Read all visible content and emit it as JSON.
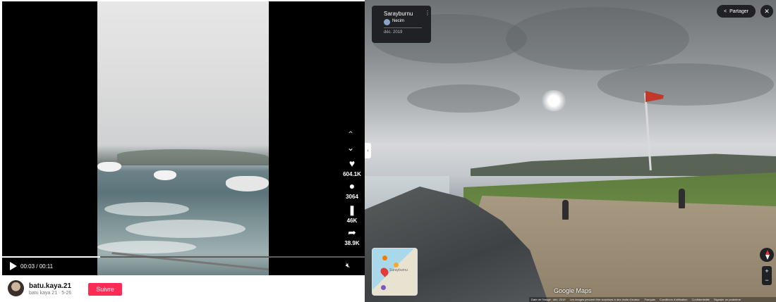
{
  "video": {
    "chevron_up": "⌃",
    "chevron_down": "⌄",
    "actions": [
      {
        "icon": "heart-icon",
        "count": "604.1K"
      },
      {
        "icon": "comment-icon",
        "count": "3064"
      },
      {
        "icon": "bookmark-icon",
        "count": "46K"
      },
      {
        "icon": "share-icon",
        "count": "38.9K"
      }
    ],
    "time": "00:03 / 00:11",
    "progress": 0.27
  },
  "author": {
    "username": "batu.kaya.21",
    "subline": "batu kaya 21 · 5-26",
    "follow_label": "Suivre"
  },
  "streetview": {
    "place": "Sarayburnu",
    "contributor": "Necim",
    "date": "déc. 2019",
    "share_label": "Partager",
    "minimap_label": "Sarayburnu",
    "logo": "Google Maps",
    "footer": [
      "Date de l'image : déc. 2019",
      "Les images peuvent être soumises à des droits d'auteur.",
      "Français",
      "Conditions d'utilisation",
      "Confidentialité",
      "Signaler un problème"
    ]
  },
  "colors": {
    "follow": "#fe2c55",
    "flag": "#c0392b"
  }
}
